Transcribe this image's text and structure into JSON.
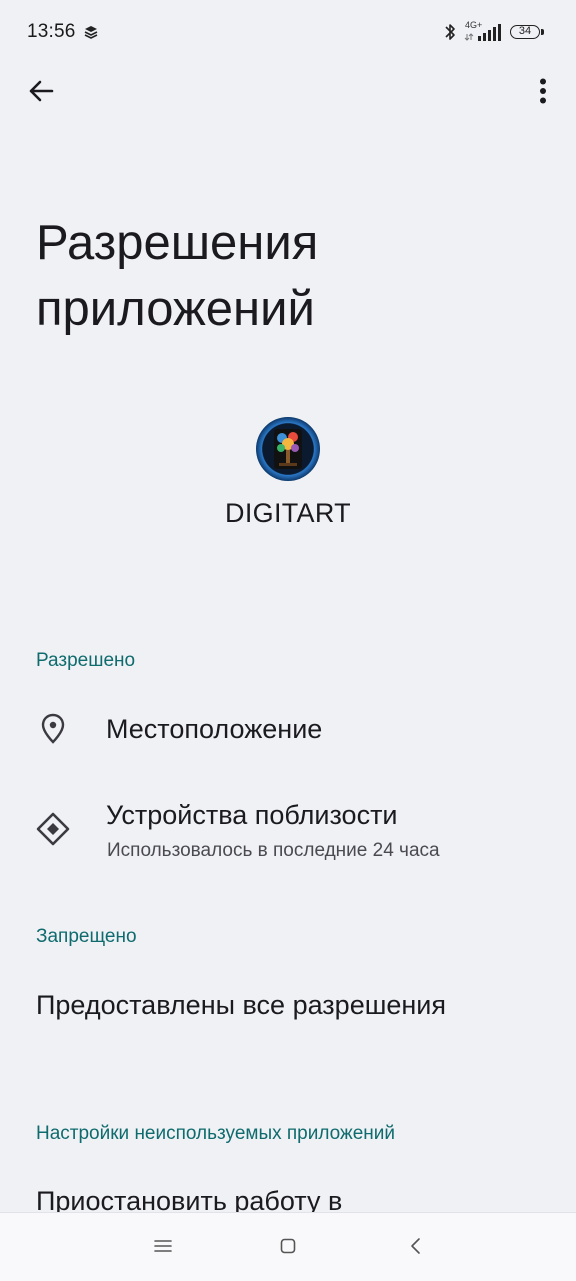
{
  "status_bar": {
    "time": "13:56",
    "network_label": "4G+",
    "battery_level": "34"
  },
  "toolbar": {
    "back_icon": "arrow-left-icon",
    "more_icon": "more-vertical-icon"
  },
  "page": {
    "title": "Разрешения приложений"
  },
  "app": {
    "name": "DIGITART",
    "icon": "app-logo-tree"
  },
  "sections": {
    "allowed": {
      "header": "Разрешено",
      "items": [
        {
          "title": "Местоположение",
          "icon": "location-pin-icon"
        },
        {
          "title": "Устройства поблизости",
          "subtitle": "Использовалось в последние 24 часа",
          "icon": "nearby-devices-icon"
        }
      ]
    },
    "denied": {
      "header": "Запрещено",
      "items": [
        {
          "title": "Предоставлены все разрешения"
        }
      ]
    },
    "unused": {
      "header": "Настройки неиспользуемых приложений",
      "items": [
        {
          "title": "Приостановить работу в"
        }
      ]
    }
  },
  "nav_bar": {
    "menu_icon": "menu-icon",
    "home_icon": "home-square-icon",
    "back_icon": "chevron-left-icon"
  },
  "colors": {
    "background": "#eff1f5",
    "accent": "#0f6b6d",
    "text_primary": "#1b1b1f"
  }
}
